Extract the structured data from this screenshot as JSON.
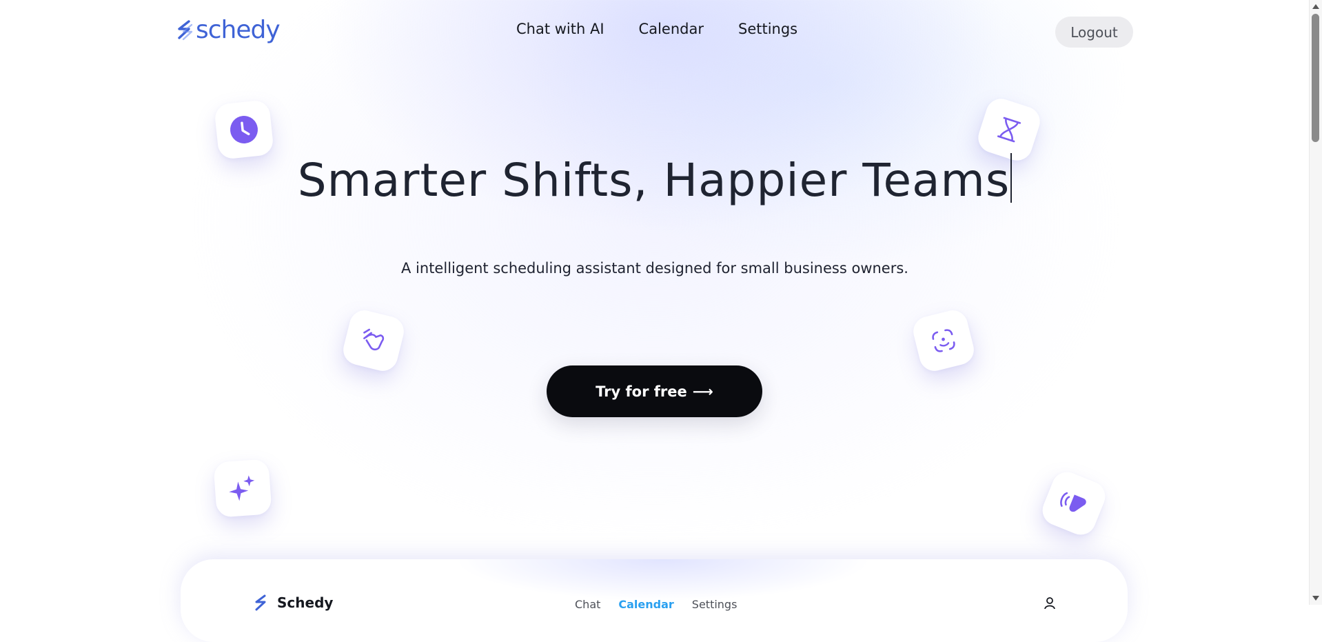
{
  "brand": {
    "name": "schedy",
    "color": "#3f63d6"
  },
  "nav": {
    "items": [
      "Chat with AI",
      "Calendar",
      "Settings"
    ]
  },
  "logout_label": "Logout",
  "hero": {
    "title": "Smarter Shifts, Happier Teams",
    "subtitle": "A intelligent scheduling assistant designed for small business owners.",
    "cta_label": "Try for free",
    "cta_arrow": "⟶"
  },
  "badges": [
    {
      "icon": "clock-icon"
    },
    {
      "icon": "hourglass-icon"
    },
    {
      "icon": "tap-hand-icon"
    },
    {
      "icon": "face-scan-icon"
    },
    {
      "icon": "sparkles-icon"
    },
    {
      "icon": "voice-tag-icon"
    }
  ],
  "preview": {
    "brand": "Schedy",
    "nav": {
      "chat": "Chat",
      "calendar": "Calendar",
      "settings": "Settings"
    },
    "active_tab": "Calendar"
  },
  "colors": {
    "accent_purple": "#7b5cf0",
    "cta_bg": "#0a0b0f",
    "preview_active": "#2aa0f0"
  }
}
